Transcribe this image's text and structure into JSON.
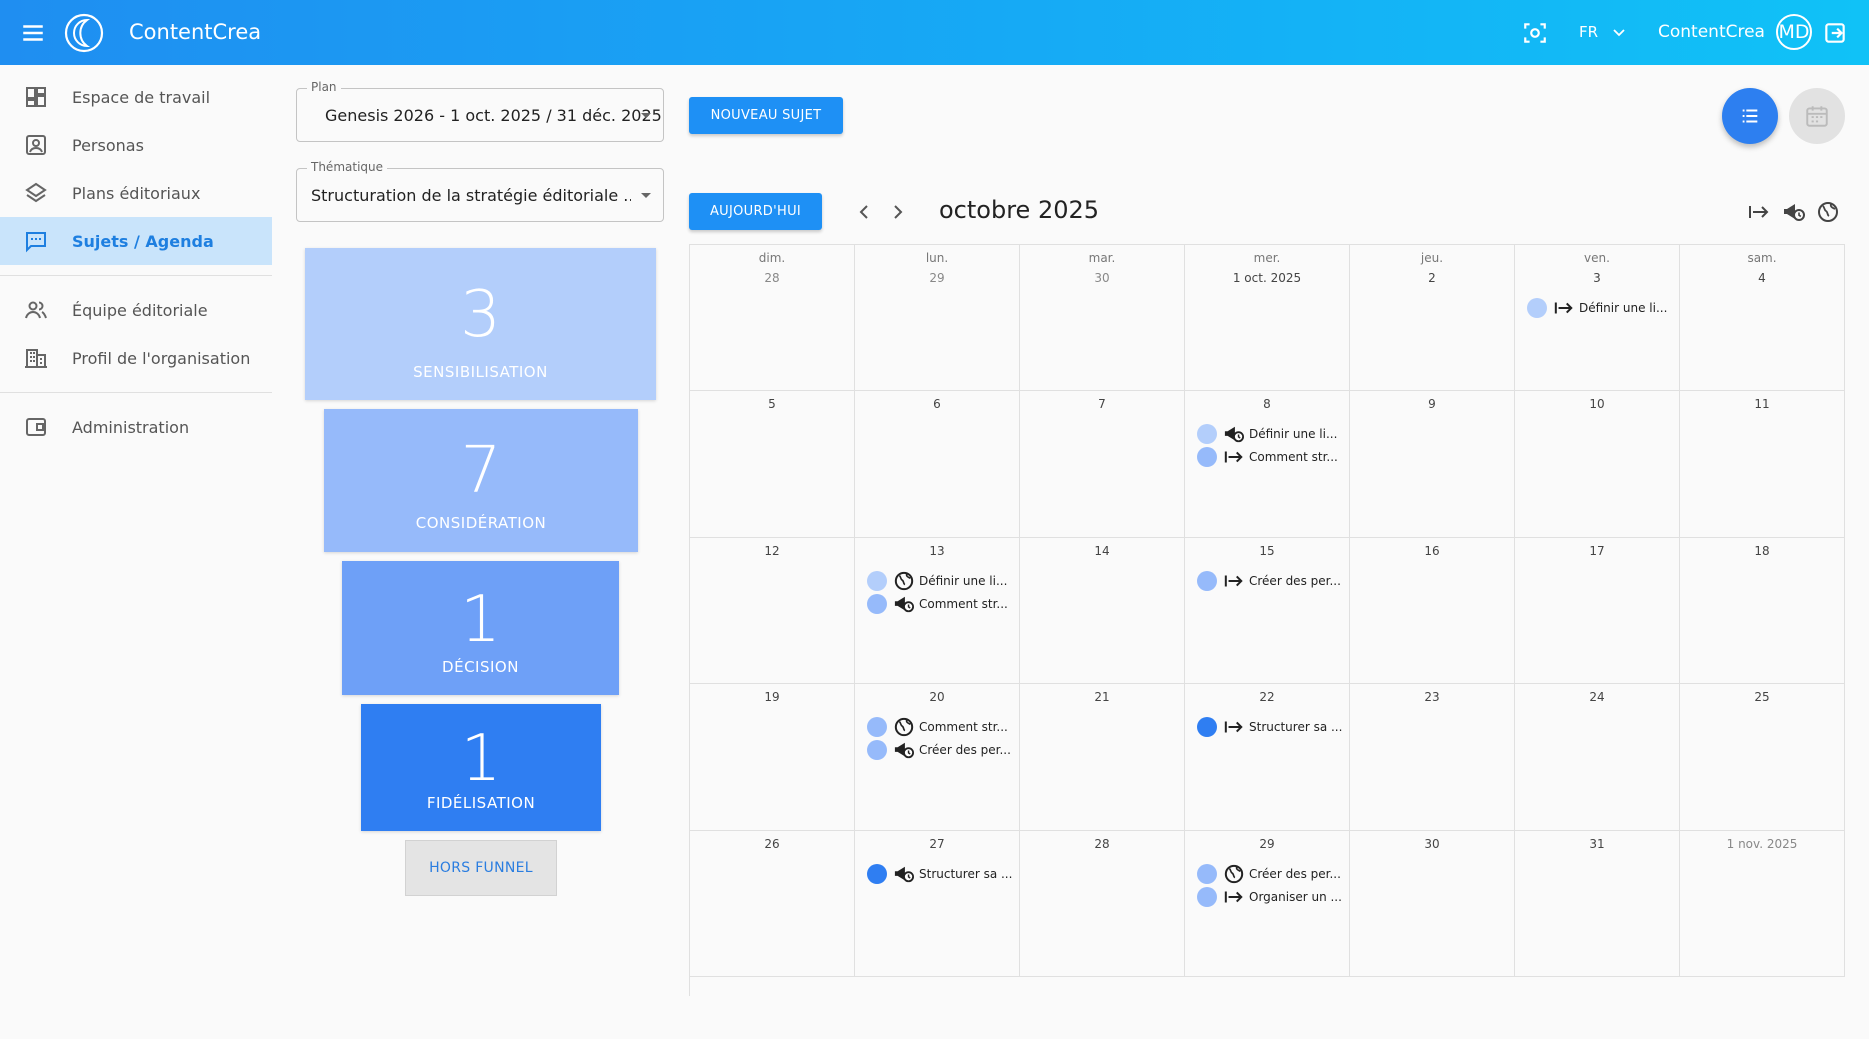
{
  "header": {
    "app_name": "ContentCrea",
    "language": "FR",
    "user_name": "ContentCrea",
    "avatar_initials": "MD",
    "color": "#1f8ef1"
  },
  "sidebar": {
    "items": [
      {
        "label": "Espace de travail",
        "icon": "dashboard-icon"
      },
      {
        "label": "Personas",
        "icon": "persona-icon"
      },
      {
        "label": "Plans éditoriaux",
        "icon": "layers-icon"
      },
      {
        "label": "Sujets / Agenda",
        "icon": "chat-icon",
        "active": true
      },
      {
        "label": "Équipe éditoriale",
        "icon": "people-icon"
      },
      {
        "label": "Profil de l'organisation",
        "icon": "building-icon"
      },
      {
        "label": "Administration",
        "icon": "admin-icon"
      }
    ]
  },
  "filters": {
    "plan": {
      "label": "Plan",
      "value": "Genesis 2026 - 1 oct. 2025 / 31 déc. 2025"
    },
    "thematique": {
      "label": "Thématique",
      "value": "Structuration de la stratégie éditoriale ..."
    }
  },
  "funnel": {
    "stages": [
      {
        "count": "3",
        "label": "SENSIBILISATION",
        "color": "#b3cefb"
      },
      {
        "count": "7",
        "label": "CONSIDÉRATION",
        "color": "#96bafa"
      },
      {
        "count": "1",
        "label": "DÉCISION",
        "color": "#6ea0f7"
      },
      {
        "count": "1",
        "label": "FIDÉLISATION",
        "color": "#2f7ef2"
      }
    ],
    "outside": "HORS FUNNEL"
  },
  "toolbar": {
    "new_subject": "NOUVEAU SUJET",
    "today": "AUJOURD'HUI",
    "month_title": "octobre 2025"
  },
  "calendar": {
    "weekdays": [
      "dim.",
      "lun.",
      "mar.",
      "mer.",
      "jeu.",
      "ven.",
      "sam."
    ],
    "weeks": [
      [
        "28",
        "29",
        "30",
        "1 oct. 2025",
        "2",
        "3",
        "4"
      ],
      [
        "5",
        "6",
        "7",
        "8",
        "9",
        "10",
        "11"
      ],
      [
        "12",
        "13",
        "14",
        "15",
        "16",
        "17",
        "18"
      ],
      [
        "19",
        "20",
        "21",
        "22",
        "23",
        "24",
        "25"
      ],
      [
        "26",
        "27",
        "28",
        "29",
        "30",
        "31",
        "1 nov. 2025"
      ]
    ],
    "events": [
      {
        "week": 0,
        "day": 5,
        "slot": 0,
        "icon": "arrow-right-bar-icon",
        "title": "Définir une li...",
        "color": "#b3cefb"
      },
      {
        "week": 1,
        "day": 3,
        "slot": 0,
        "icon": "megaphone-clock-icon",
        "title": "Définir une li...",
        "color": "#b3cefb"
      },
      {
        "week": 1,
        "day": 3,
        "slot": 1,
        "icon": "arrow-right-bar-icon",
        "title": "Comment str...",
        "color": "#96bafa"
      },
      {
        "week": 2,
        "day": 1,
        "slot": 0,
        "icon": "globe-icon",
        "title": "Définir une li...",
        "color": "#b3cefb"
      },
      {
        "week": 2,
        "day": 1,
        "slot": 1,
        "icon": "megaphone-clock-icon",
        "title": "Comment str...",
        "color": "#96bafa"
      },
      {
        "week": 2,
        "day": 3,
        "slot": 0,
        "icon": "arrow-right-bar-icon",
        "title": "Créer des per...",
        "color": "#96bafa"
      },
      {
        "week": 3,
        "day": 1,
        "slot": 0,
        "icon": "globe-icon",
        "title": "Comment str...",
        "color": "#96bafa"
      },
      {
        "week": 3,
        "day": 1,
        "slot": 1,
        "icon": "megaphone-clock-icon",
        "title": "Créer des per...",
        "color": "#96bafa"
      },
      {
        "week": 3,
        "day": 3,
        "slot": 0,
        "icon": "arrow-right-bar-icon",
        "title": "Structurer sa ...",
        "color": "#2f7ef2"
      },
      {
        "week": 4,
        "day": 1,
        "slot": 0,
        "icon": "megaphone-clock-icon",
        "title": "Structurer sa ...",
        "color": "#2f7ef2"
      },
      {
        "week": 4,
        "day": 3,
        "slot": 0,
        "icon": "globe-icon",
        "title": "Créer des per...",
        "color": "#96bafa"
      },
      {
        "week": 4,
        "day": 3,
        "slot": 1,
        "icon": "arrow-right-bar-icon",
        "title": "Organiser un ...",
        "color": "#96bafa"
      }
    ]
  }
}
